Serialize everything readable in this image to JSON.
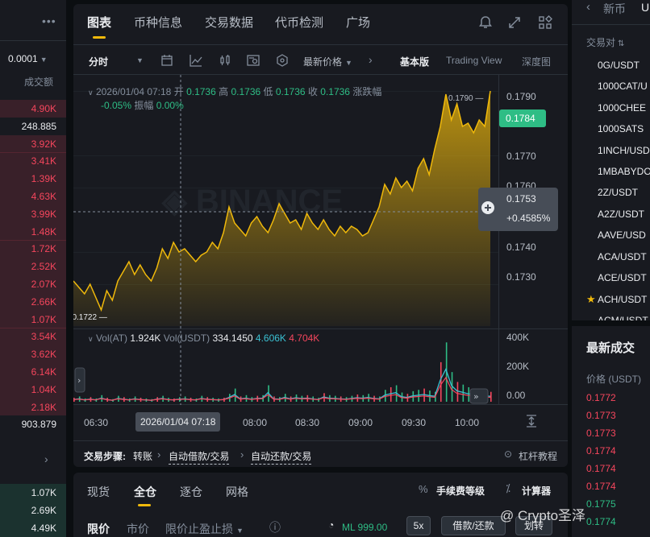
{
  "left": {
    "precision": "0.0001",
    "vol_header": "成交额",
    "asks": [
      "4.90K",
      "248.885",
      "3.92K",
      "3.41K",
      "1.39K",
      "4.63K",
      "3.99K",
      "1.48K",
      "1.72K",
      "2.52K",
      "2.07K",
      "2.66K",
      "1.07K",
      "3.54K",
      "3.62K",
      "6.14K",
      "1.04K",
      "2.18K",
      "903.879"
    ],
    "bids": [
      "1.07K",
      "2.69K",
      "4.49K"
    ]
  },
  "header": {
    "tabs": [
      "图表",
      "币种信息",
      "交易数据",
      "代币检测",
      "广场"
    ]
  },
  "toolbar": {
    "interval": "分时",
    "price_type": "最新价格",
    "views": [
      "基本版",
      "Trading View",
      "深度图"
    ]
  },
  "ohlc": {
    "datetime": "2026/01/04 07:18",
    "open_label": "开",
    "open": "0.1736",
    "high_label": "高",
    "high": "0.1736",
    "low_label": "低",
    "low": "0.1736",
    "close_label": "收",
    "close": "0.1736",
    "change_label": "涨跌幅",
    "change": "-0.05%",
    "amp_label": "振幅",
    "amp": "0.00%"
  },
  "volume_info": {
    "label1": "Vol(AT)",
    "value1": "1.924K",
    "label2": "Vol(USDT)",
    "value2": "334.1450",
    "value3": "4.606K",
    "value4": "4.704K"
  },
  "chart_data": {
    "type": "area",
    "price_axis": [
      "0.1790",
      "0.1770",
      "0.1760",
      "0.1740",
      "0.1730"
    ],
    "volume_axis": [
      "400K",
      "200K",
      "0.00"
    ],
    "time_labels": [
      "06:30",
      "08:00",
      "08:30",
      "09:00",
      "09:30",
      "10:00"
    ],
    "cursor_time": "2026/01/04 07:18",
    "current_price": "0.1784",
    "crosshair_price": "0.1753",
    "crosshair_change": "+0.4585%",
    "high_marker": "0.1790",
    "low_marker": "0.1722",
    "ylim": [
      0.1717,
      0.1795
    ],
    "price_series": [
      0.1731,
      0.1729,
      0.1727,
      0.173,
      0.1726,
      0.1722,
      0.1728,
      0.1725,
      0.1731,
      0.1734,
      0.1737,
      0.1733,
      0.1736,
      0.1733,
      0.1731,
      0.1735,
      0.1741,
      0.1738,
      0.1743,
      0.174,
      0.1741,
      0.1739,
      0.1737,
      0.1739,
      0.174,
      0.1743,
      0.1741,
      0.1746,
      0.1754,
      0.1749,
      0.1747,
      0.1745,
      0.1749,
      0.1751,
      0.1748,
      0.1746,
      0.175,
      0.1755,
      0.1752,
      0.1749,
      0.175,
      0.1747,
      0.1752,
      0.1749,
      0.1747,
      0.175,
      0.1747,
      0.1745,
      0.1748,
      0.1746,
      0.1748,
      0.1747,
      0.1745,
      0.1746,
      0.175,
      0.1754,
      0.1761,
      0.1758,
      0.1763,
      0.176,
      0.1762,
      0.1759,
      0.1766,
      0.1769,
      0.1764,
      0.1772,
      0.1779,
      0.1789,
      0.1781,
      0.1786,
      0.1779,
      0.178,
      0.1777,
      0.1781,
      0.1779,
      0.179
    ],
    "volume_series": [
      6,
      8,
      5,
      7,
      5,
      10,
      6,
      4,
      9,
      7,
      5,
      8,
      6,
      5,
      4,
      7,
      9,
      6,
      5,
      7,
      8,
      6,
      5,
      9,
      7,
      6,
      5,
      6,
      12,
      20,
      8,
      10,
      7,
      9,
      10,
      25,
      8,
      7,
      12,
      8,
      11,
      9,
      10,
      8,
      6,
      13,
      10,
      9,
      8,
      7,
      9,
      11,
      10,
      12,
      9,
      8,
      18,
      22,
      25,
      14,
      12,
      16,
      18,
      20,
      17,
      15,
      60,
      90,
      45,
      30,
      26,
      22,
      20,
      18,
      16,
      15
    ]
  },
  "steps": {
    "title": "交易步骤:",
    "items": [
      "转账",
      "自动借款/交易",
      "自动还款/交易"
    ],
    "tutorial": "杠杆教程"
  },
  "bottom": {
    "tabs": [
      "现货",
      "全仓",
      "逐仓",
      "网格"
    ],
    "fee_label": "手续费等级",
    "calc_label": "计算器",
    "order_types": [
      "限价",
      "市价",
      "限价止盈止损"
    ],
    "ml": "ML 999.00",
    "leverage": "5x",
    "borrow_btn": "借款/还款",
    "transfer_btn": "划转"
  },
  "right": {
    "tab_new": "新币",
    "tab_u": "U",
    "pair_label": "交易对",
    "pairs": [
      "0G/USDT",
      "1000CAT/U",
      "1000CHEE",
      "1000SATS",
      "1INCH/USD",
      "1MBABYDO",
      "2Z/USDT",
      "A2Z/USDT",
      "AAVE/USD",
      "ACA/USDT",
      "ACE/USDT",
      "ACH/USDT",
      "ACM/USDT"
    ],
    "trades_title": "最新成交",
    "trades_price_header": "价格 (USDT)",
    "trades": [
      "0.1772",
      "0.1773",
      "0.1773",
      "0.1774",
      "0.1774",
      "0.1774",
      "0.1775",
      "0.1774"
    ]
  },
  "watermark": "@ Crypto圣泽",
  "colors": {
    "accent": "#f0b90b",
    "up": "#2ebd85",
    "down": "#f6465d",
    "bg": "#181a20"
  }
}
